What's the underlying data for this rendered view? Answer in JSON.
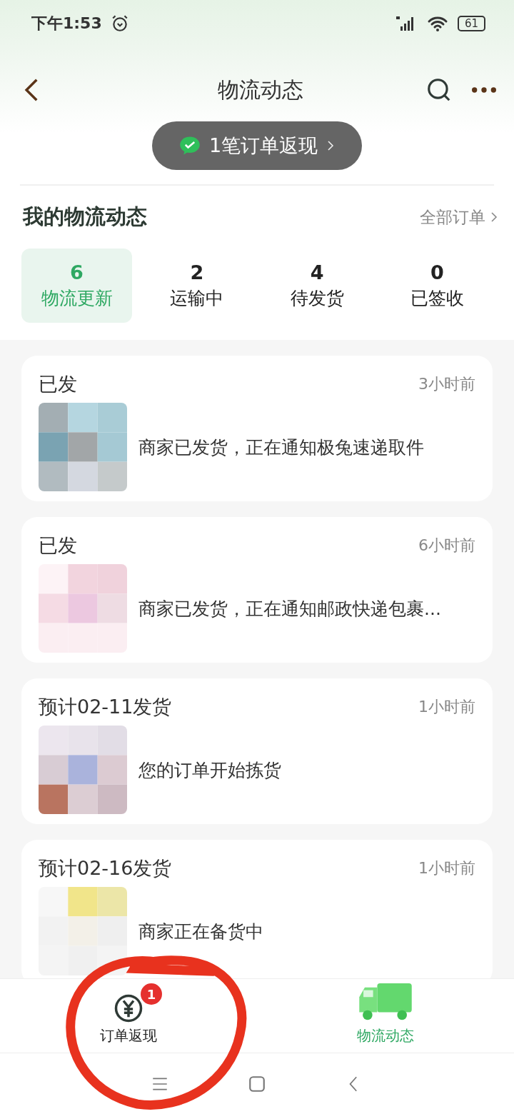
{
  "status_bar": {
    "time": "下午1:53",
    "battery": "61"
  },
  "header": {
    "title": "物流动态"
  },
  "cashback_banner": {
    "text": "1笔订单返现"
  },
  "section": {
    "title": "我的物流动态",
    "link": "全部订单"
  },
  "stats": [
    {
      "count": "6",
      "label": "物流更新",
      "selected": true
    },
    {
      "count": "2",
      "label": "运输中",
      "selected": false
    },
    {
      "count": "4",
      "label": "待发货",
      "selected": false
    },
    {
      "count": "0",
      "label": "已签收",
      "selected": false
    }
  ],
  "shipments": [
    {
      "status": "已发",
      "time": "3小时前",
      "message": "商家已发货，正在通知极兔速递取件"
    },
    {
      "status": "已发",
      "time": "6小时前",
      "message": "商家已发货，正在通知邮政快递包裹..."
    },
    {
      "status": "预计02-11发货",
      "time": "1小时前",
      "message": "您的订单开始拣货"
    },
    {
      "status": "预计02-16发货",
      "time": "1小时前",
      "message": "商家正在备货中"
    }
  ],
  "bottom_tabs": [
    {
      "kind": "cashback",
      "label": "订单返现",
      "badge": "1",
      "selected": false
    },
    {
      "kind": "logistics",
      "label": "物流动态",
      "selected": true
    }
  ],
  "annotation": {
    "color": "#e8321e"
  }
}
